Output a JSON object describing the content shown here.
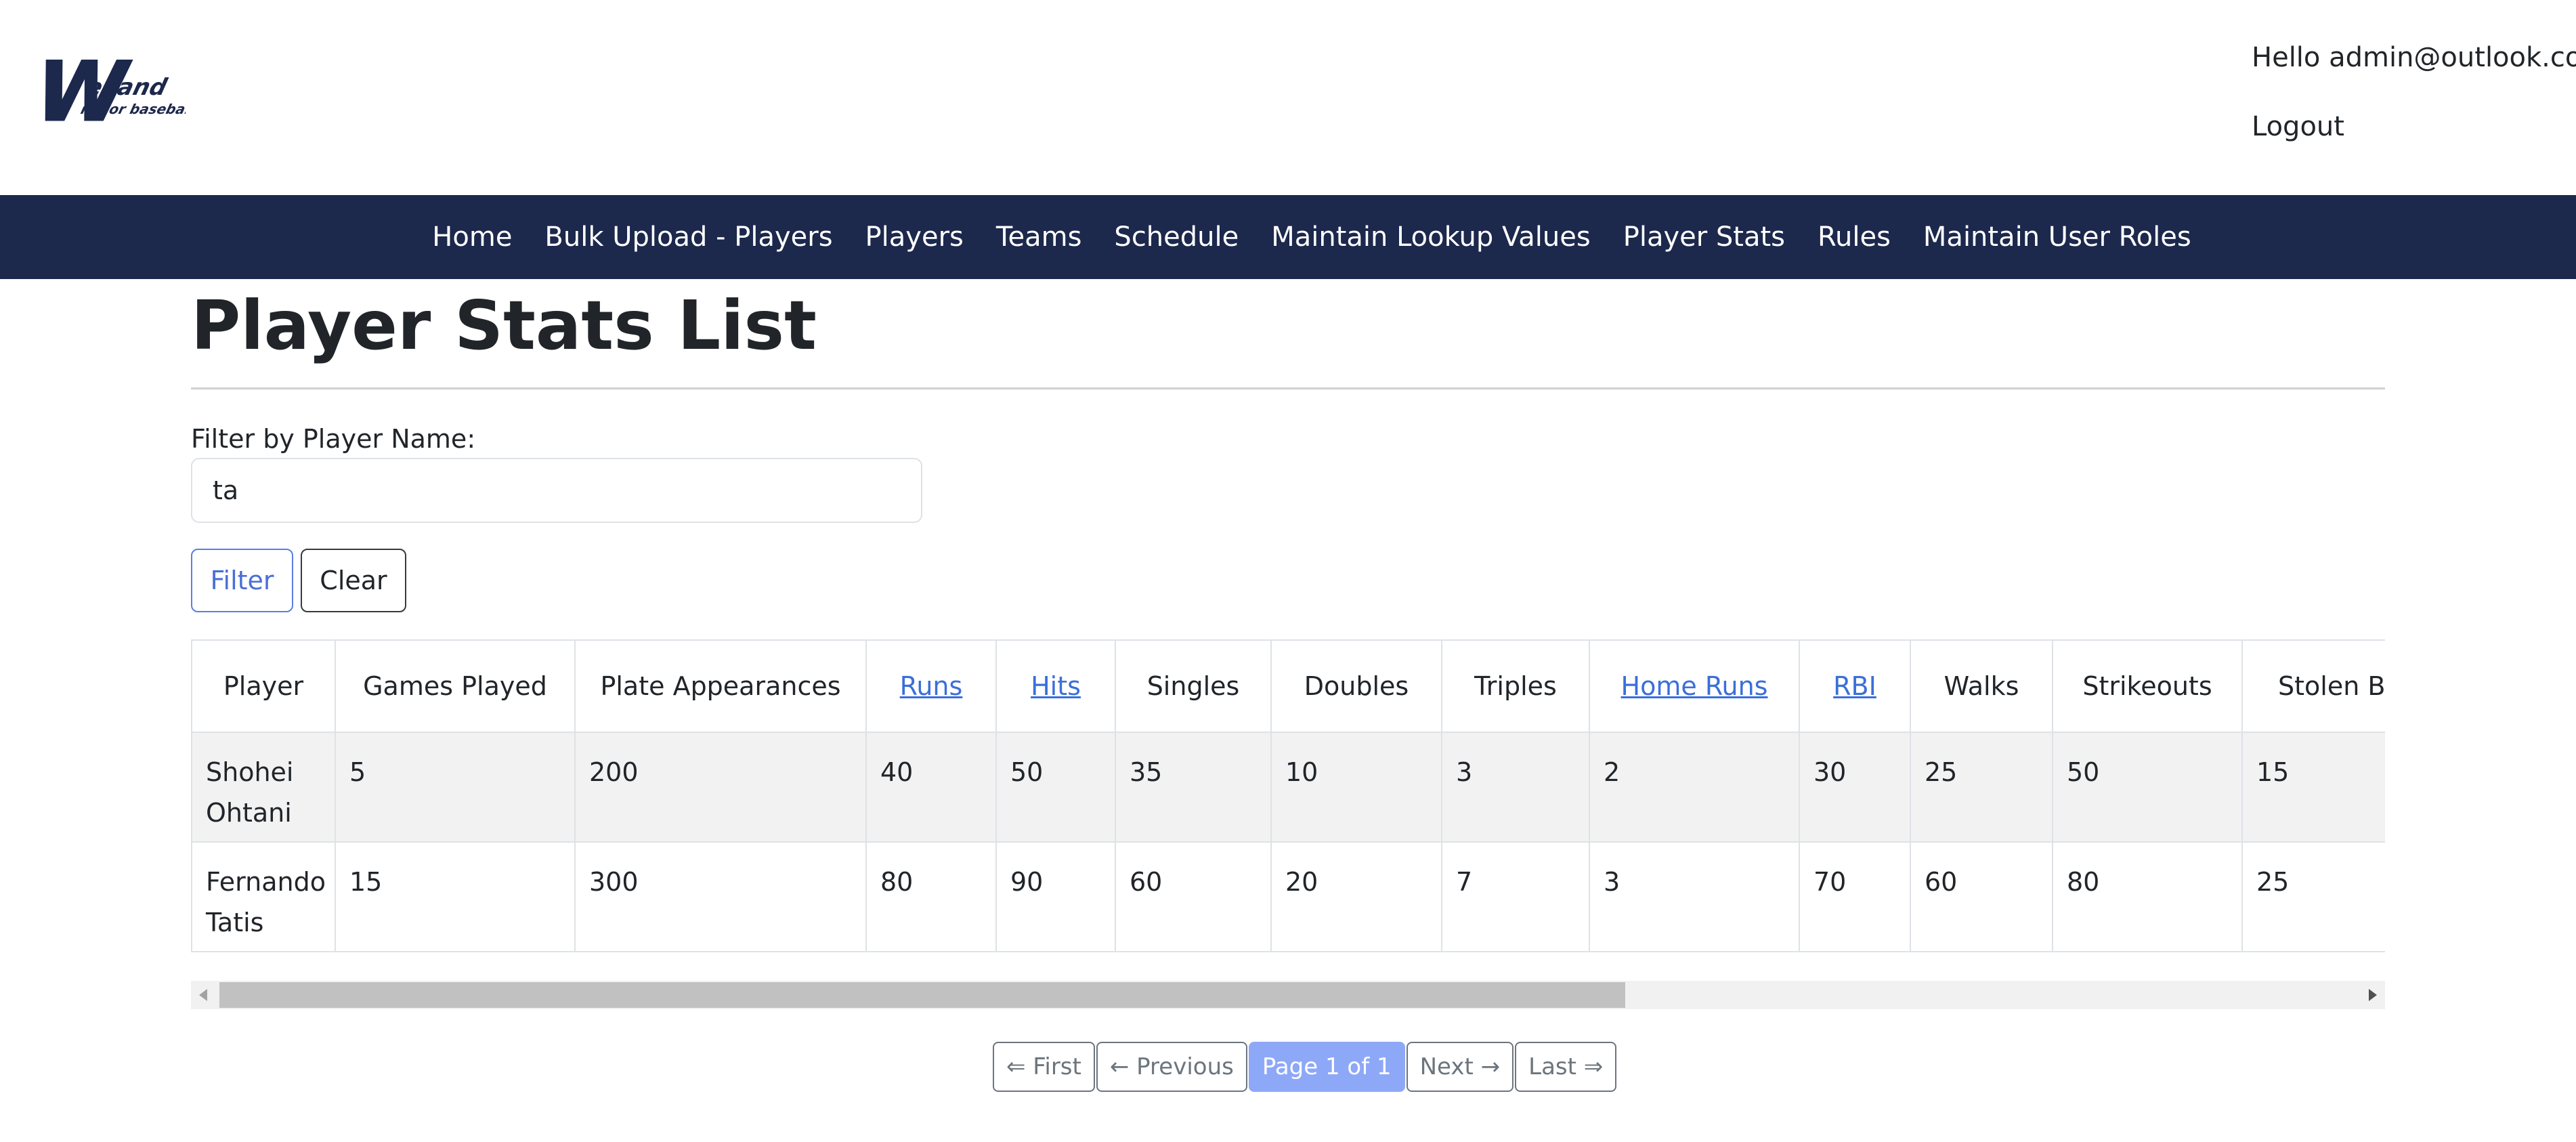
{
  "header": {
    "logo_text": "Welland minor baseball",
    "greeting": "Hello admin@outlook.com!",
    "logout_label": "Logout"
  },
  "nav": {
    "items": [
      "Home",
      "Bulk Upload - Players",
      "Players",
      "Teams",
      "Schedule",
      "Maintain Lookup Values",
      "Player Stats",
      "Rules",
      "Maintain User Roles"
    ]
  },
  "page": {
    "title": "Player Stats List"
  },
  "filter": {
    "label": "Filter by Player Name:",
    "value": "ta",
    "filter_button": "Filter",
    "clear_button": "Clear"
  },
  "table": {
    "headers": [
      "Player",
      "Games Played",
      "Plate Appearances",
      "Runs",
      "Hits",
      "Singles",
      "Doubles",
      "Triples",
      "Home Runs",
      "RBI",
      "Walks",
      "Strikeouts",
      "Stolen Bases"
    ],
    "rows": [
      [
        "Shohei Ohtani",
        "5",
        "200",
        "40",
        "50",
        "35",
        "10",
        "3",
        "2",
        "30",
        "25",
        "50",
        "15"
      ],
      [
        "Fernando Tatis",
        "15",
        "300",
        "80",
        "90",
        "60",
        "20",
        "7",
        "3",
        "70",
        "60",
        "80",
        "25"
      ]
    ]
  },
  "pagination": {
    "first": "⇐ First",
    "previous": "← Previous",
    "current": "Page 1 of 1",
    "next": "Next →",
    "last": "Last ⇒"
  },
  "colors": {
    "navbar": "#1c284c",
    "link": "#3b6fd8",
    "active_page": "#8ea8f8"
  }
}
